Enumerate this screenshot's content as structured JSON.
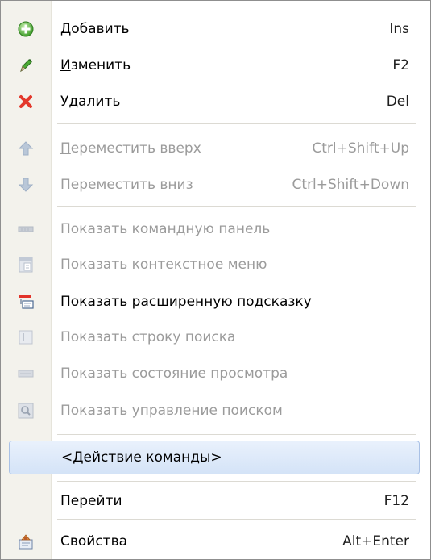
{
  "menu": {
    "items": [
      {
        "access": "Д",
        "label": "обавить",
        "shortcut": "Ins",
        "icon": "add-circle-icon"
      },
      {
        "access": "И",
        "label": "зменить",
        "shortcut": "F2",
        "icon": "pencil-icon"
      },
      {
        "access": "У",
        "label": "далить",
        "shortcut": "Del",
        "icon": "delete-x-icon"
      },
      {
        "access": "П",
        "label": "ереместить вверх",
        "shortcut": "Ctrl+Shift+Up",
        "icon": "arrow-up-icon"
      },
      {
        "access": "П",
        "label": "ереместить вниз",
        "shortcut": "Ctrl+Shift+Down",
        "icon": "arrow-down-icon"
      },
      {
        "label": "Показать командную панель",
        "icon": "command-panel-icon"
      },
      {
        "label": "Показать контекстное меню",
        "icon": "context-menu-icon"
      },
      {
        "label": "Показать расширенную подсказку",
        "icon": "extended-tooltip-icon"
      },
      {
        "label": "Показать строку поиска",
        "icon": "search-bar-icon"
      },
      {
        "label": "Показать состояние просмотра",
        "icon": "view-state-icon"
      },
      {
        "label": "Показать управление поиском",
        "icon": "search-control-icon"
      },
      {
        "label": "<Действие команды>"
      },
      {
        "label": "Перейти",
        "shortcut": "F12"
      },
      {
        "label": "Свойства",
        "shortcut": "Alt+Enter",
        "icon": "properties-icon"
      }
    ]
  },
  "colors": {
    "enabled_text": "#000000",
    "disabled_text": "#9b9b9b",
    "highlight_border": "#a9c1e6",
    "highlight_fill": "#dce8f9",
    "gutter": "#f3f2ec"
  }
}
